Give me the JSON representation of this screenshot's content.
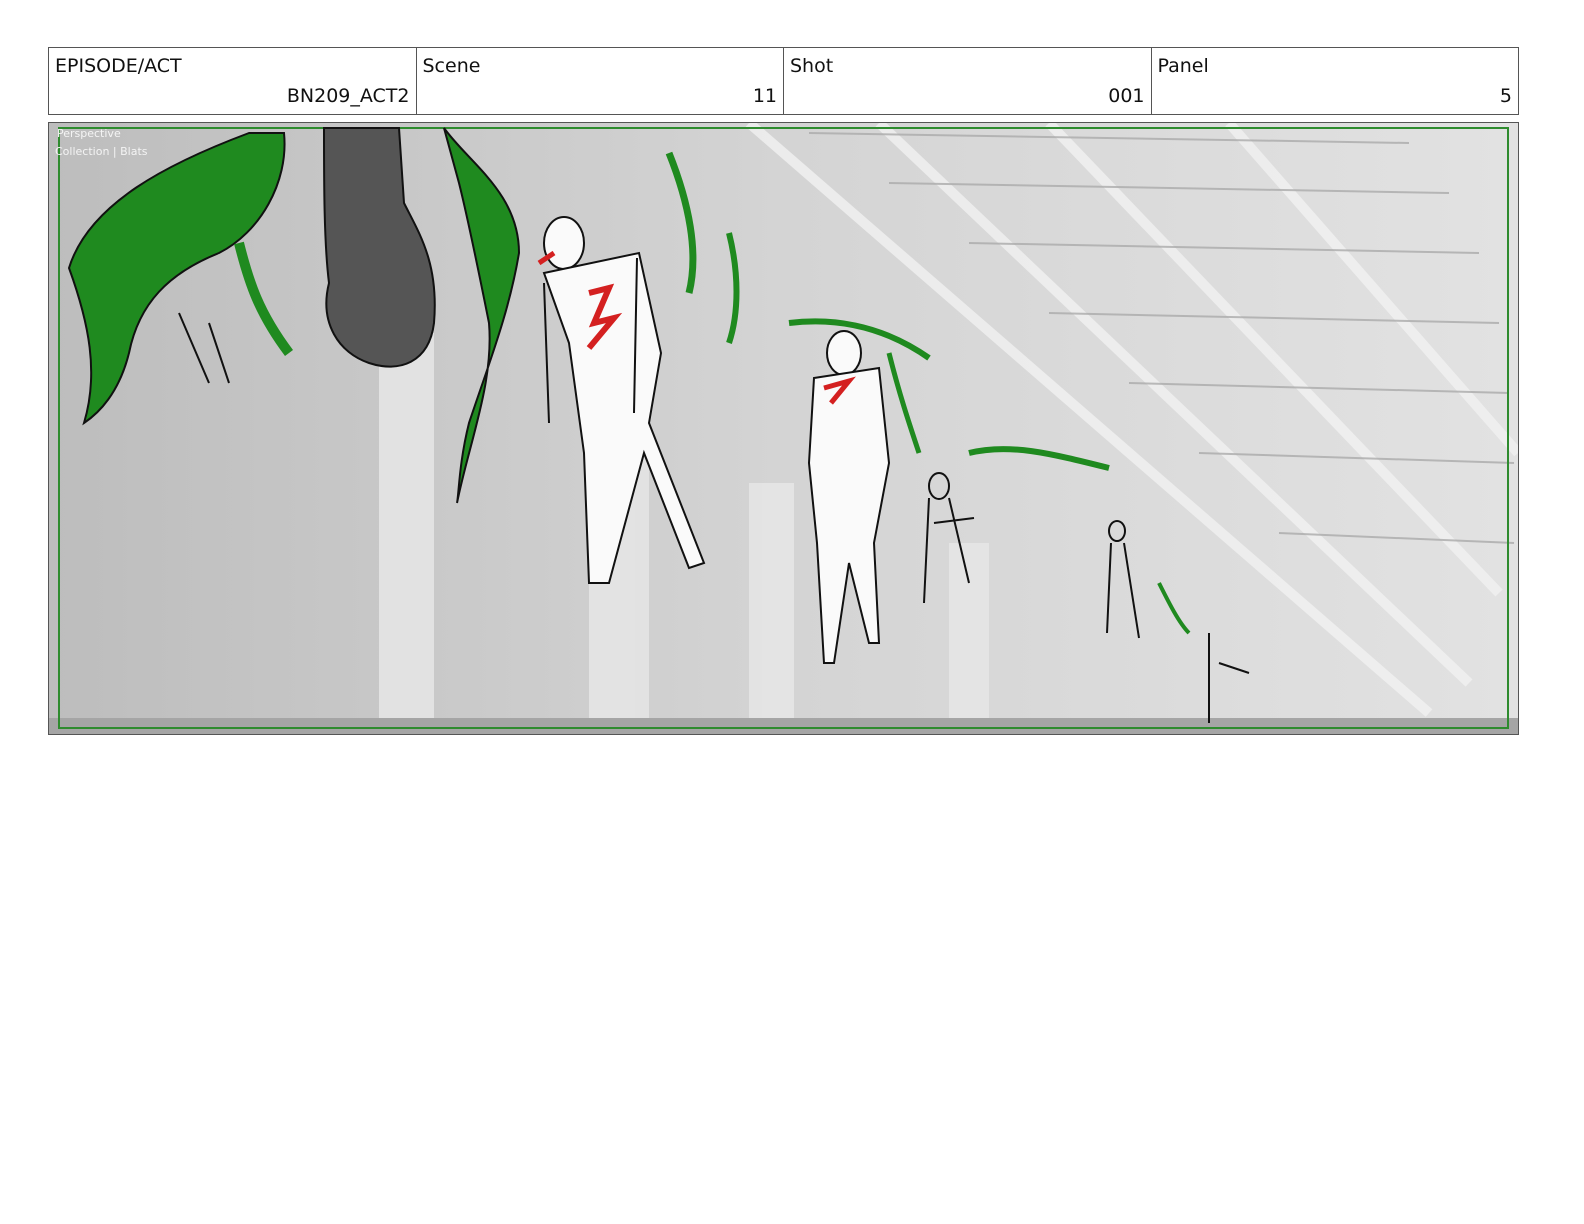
{
  "header": {
    "episode_label": "EPISODE/ACT",
    "episode_value": "BN209_ACT2",
    "scene_label": "Scene",
    "scene_value": "11",
    "shot_label": "Shot",
    "shot_value": "001",
    "panel_label": "Panel",
    "panel_value": "5"
  },
  "panel_overlay": {
    "line1": "Perspective",
    "line2": "Collection | Blats"
  },
  "colors": {
    "vine_green": "#1f8a1f",
    "wound_red": "#d42020",
    "hand_gray": "#555555",
    "background_gray": "#c8c8c8",
    "frame_green": "#2e8b2e"
  }
}
